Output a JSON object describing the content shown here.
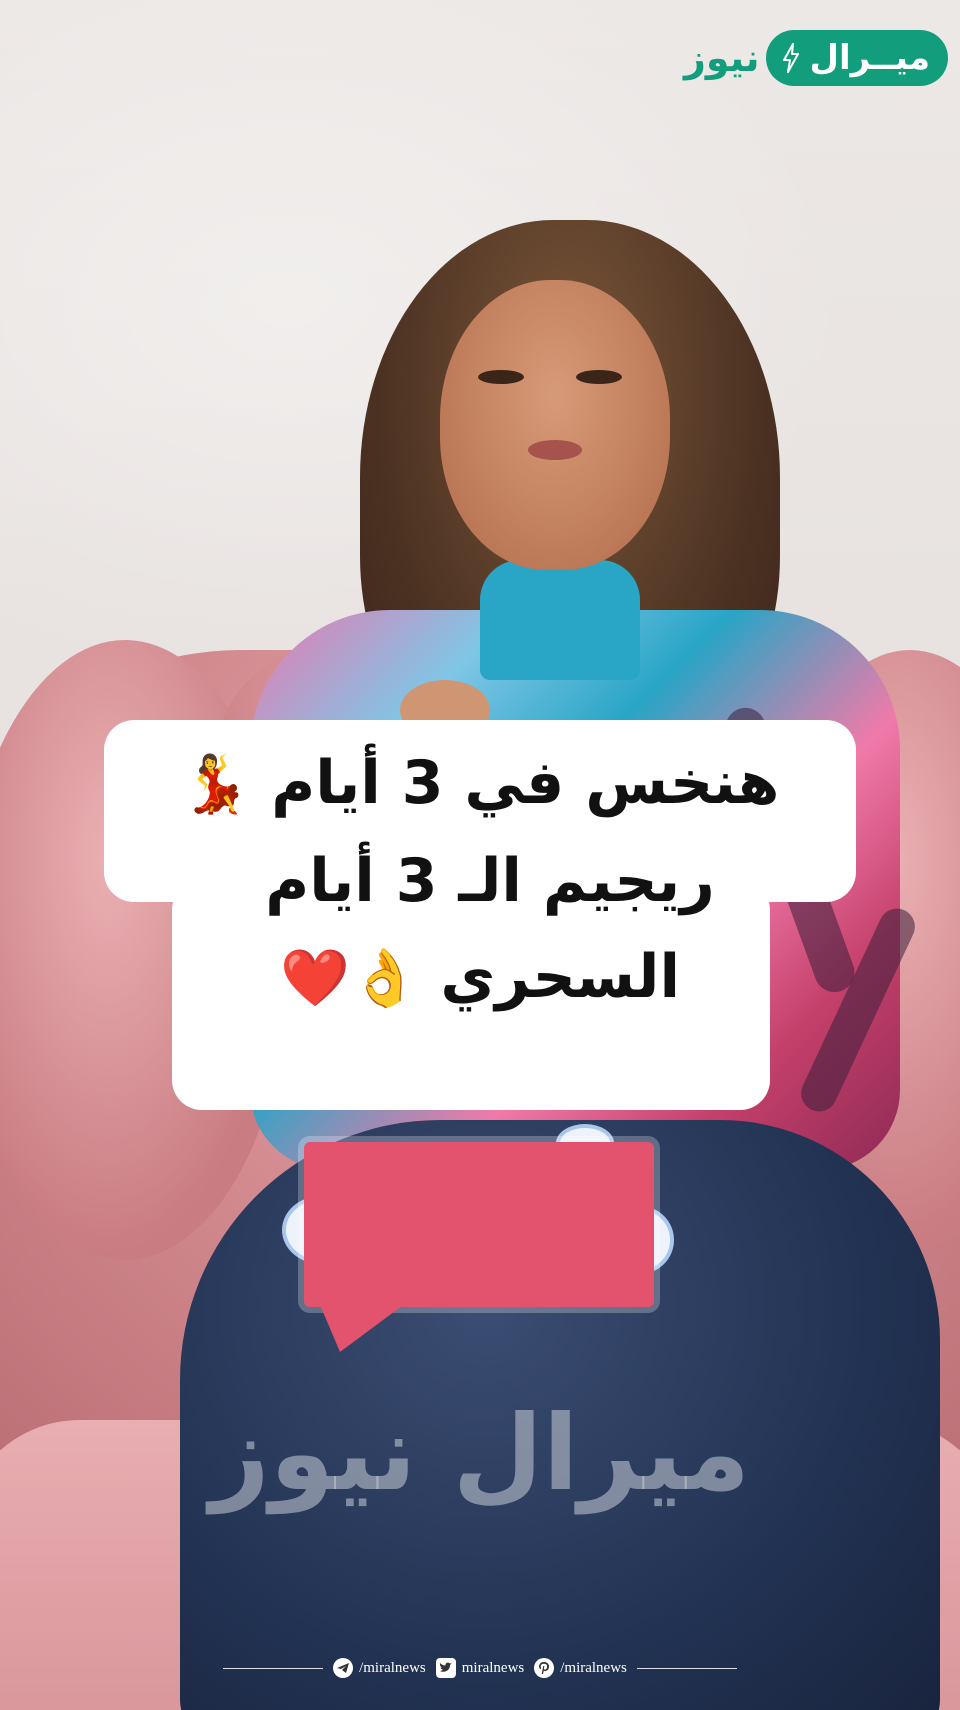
{
  "brand": {
    "logo_pill_text": "ميــرال",
    "logo_word": "نيوز",
    "accent": "#129d7c"
  },
  "caption": {
    "line1": "هنخس في 3 أيام",
    "line1_emoji": "💃",
    "line2": "ريجيم الـ 3 أيام",
    "line3": "السحري",
    "line3_emoji": "👌❤️"
  },
  "watermark": "ميرال نيوز",
  "footer": {
    "telegram": "/miralnews",
    "twitter": "miralnews",
    "pinterest": "/miralnews"
  },
  "colors": {
    "caption_bg": "#ffffff",
    "sticker_pink": "#e4536d"
  }
}
